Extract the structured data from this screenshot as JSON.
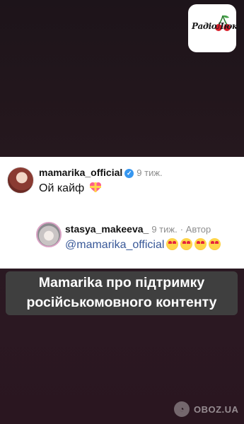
{
  "logo": {
    "text": "РадіоЛюкс",
    "cherry_color": "#d81e2a"
  },
  "comment": {
    "username": "mamarika_official",
    "verified_icon": "verified-badge",
    "time": "9 тиж.",
    "text": "Ой кайф",
    "emoji": "heart-with-ribbon"
  },
  "reply": {
    "username": "stasya_makeeva_",
    "time": "9 тиж.",
    "author_tag": "· Автор",
    "mention": "@mamarika_official",
    "emojis": [
      "heart-eyes",
      "heart-eyes",
      "heart-eyes",
      "heart-eyes"
    ]
  },
  "caption": {
    "line1": "Mamarika про підтримку",
    "line2": "російськомовного контенту"
  },
  "watermark": {
    "text": "OBOZ.UA",
    "icon": "oboz-logo-icon"
  },
  "colors": {
    "background": "#24171d",
    "card": "#ffffff",
    "mention": "#385898",
    "caption_bg": "#3f3f3f"
  }
}
